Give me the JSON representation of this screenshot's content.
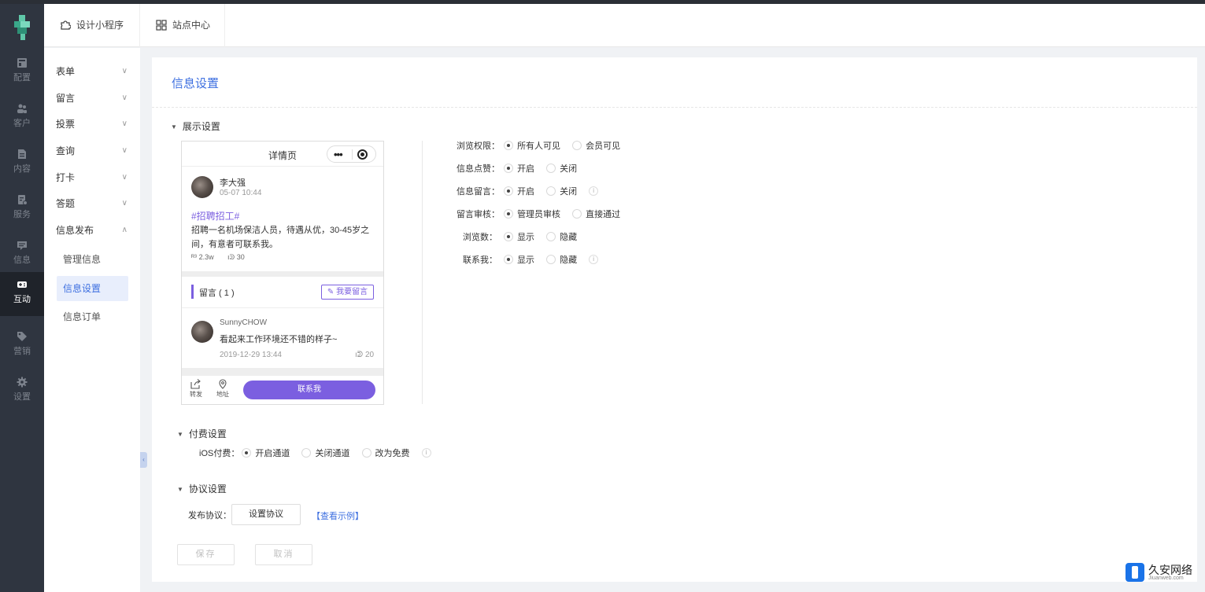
{
  "header": {
    "tabs": [
      {
        "label": "设计小程序",
        "icon": "puzzle-icon"
      },
      {
        "label": "站点中心",
        "icon": "grid-icon"
      }
    ]
  },
  "leftnav": {
    "items": [
      {
        "label": "配置",
        "icon": "layout-icon",
        "active": false
      },
      {
        "label": "客户",
        "icon": "users-icon",
        "active": false
      },
      {
        "label": "内容",
        "icon": "document-icon",
        "active": false
      },
      {
        "label": "服务",
        "icon": "service-icon",
        "active": false
      },
      {
        "label": "信息",
        "icon": "message-icon",
        "active": false
      },
      {
        "label": "互动",
        "icon": "gamepad-icon",
        "active": true
      },
      {
        "label": "营销",
        "icon": "tag-icon",
        "active": false
      },
      {
        "label": "设置",
        "icon": "gear-icon",
        "active": false
      }
    ]
  },
  "submenu": {
    "items": [
      {
        "label": "表单",
        "chevron": "∨"
      },
      {
        "label": "留言",
        "chevron": "∨"
      },
      {
        "label": "投票",
        "chevron": "∨"
      },
      {
        "label": "查询",
        "chevron": "∨"
      },
      {
        "label": "打卡",
        "chevron": "∨"
      },
      {
        "label": "答题",
        "chevron": "∨"
      },
      {
        "label": "信息发布",
        "chevron": "∧"
      }
    ],
    "sub_items": [
      {
        "label": "管理信息",
        "active": false
      },
      {
        "label": "信息设置",
        "active": true
      },
      {
        "label": "信息订单",
        "active": false
      }
    ]
  },
  "panel": {
    "title": "信息设置",
    "display_section": "展示设置",
    "pay_section": "付费设置",
    "protocol_section": "协议设置"
  },
  "phone": {
    "title": "详情页",
    "author": "李大强",
    "post_time": "05-07 10:44",
    "tag": "#招聘招工#",
    "body": "招聘一名机场保洁人员，待遇从优，30-45岁之间，有意者可联系我。",
    "views": "2.3w",
    "likes": "30",
    "comments_title": "留言 ( 1 )",
    "write_comment": "我要留言",
    "commenter": "SunnyCHOW",
    "comment_text": "看起来工作环境还不错的样子~",
    "comment_time": "2019-12-29 13:44",
    "comment_likes": "20",
    "footer": {
      "share": "转发",
      "address": "地址",
      "contact": "联系我"
    }
  },
  "settings": [
    {
      "label": "浏览权限：",
      "options": [
        "所有人可见",
        "会员可见"
      ],
      "selected": 0,
      "info": false
    },
    {
      "label": "信息点赞：",
      "options": [
        "开启",
        "关闭"
      ],
      "selected": 0,
      "info": false
    },
    {
      "label": "信息留言：",
      "options": [
        "开启",
        "关闭"
      ],
      "selected": 0,
      "info": true
    },
    {
      "label": "留言审核：",
      "options": [
        "管理员审核",
        "直接通过"
      ],
      "selected": 0,
      "info": false
    },
    {
      "label": "浏览数：",
      "options": [
        "显示",
        "隐藏"
      ],
      "selected": 0,
      "info": false
    },
    {
      "label": "联系我：",
      "options": [
        "显示",
        "隐藏"
      ],
      "selected": 0,
      "info": true
    }
  ],
  "pay": {
    "label": "iOS付费：",
    "options": [
      "开启通道",
      "关闭通道",
      "改为免费"
    ],
    "selected": 0
  },
  "protocol": {
    "label": "发布协议：",
    "button": "设置协议",
    "link": "【查看示例】"
  },
  "actions": {
    "save": "保存",
    "cancel": "取消"
  },
  "watermark": {
    "name": "久安网络",
    "domain": "Jiuanweb.com"
  },
  "colors": {
    "accent": "#3d6fe0",
    "purple": "#7b5fe0",
    "nav_bg": "#2f3540"
  }
}
